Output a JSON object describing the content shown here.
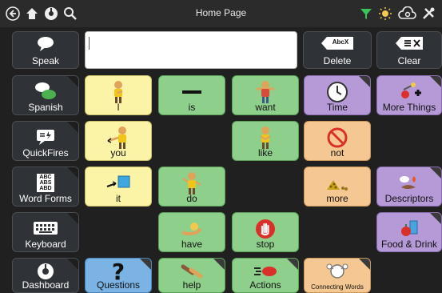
{
  "topbar": {
    "title": "Home Page"
  },
  "speak_row": {
    "speak": "Speak",
    "delete": "Delete",
    "clear": "Clear",
    "delete_key": "AbcX",
    "message": ""
  },
  "sidebar": [
    "Spanish",
    "QuickFires",
    "Word Forms",
    "Keyboard",
    "Dashboard"
  ],
  "grid": {
    "i": "I",
    "is": "is",
    "want": "want",
    "time": "Time",
    "more_things": "More Things",
    "you": "you",
    "like": "like",
    "not": "not",
    "it": "it",
    "do": "do",
    "more": "more",
    "descriptors": "Descriptors",
    "have": "have",
    "stop": "stop",
    "food_drink": "Food & Drink",
    "questions": "Questions",
    "help": "help",
    "actions": "Actions",
    "connecting_words": "Connecting Words"
  },
  "word_forms_icon_text": "ABC\nABS\nABD",
  "colors": {
    "yellow": "#fbf3a6",
    "green": "#8fcf8c",
    "purple": "#b69ad8",
    "orange": "#f5c893",
    "blue": "#7bb3e4",
    "dark": "#2f3236"
  }
}
